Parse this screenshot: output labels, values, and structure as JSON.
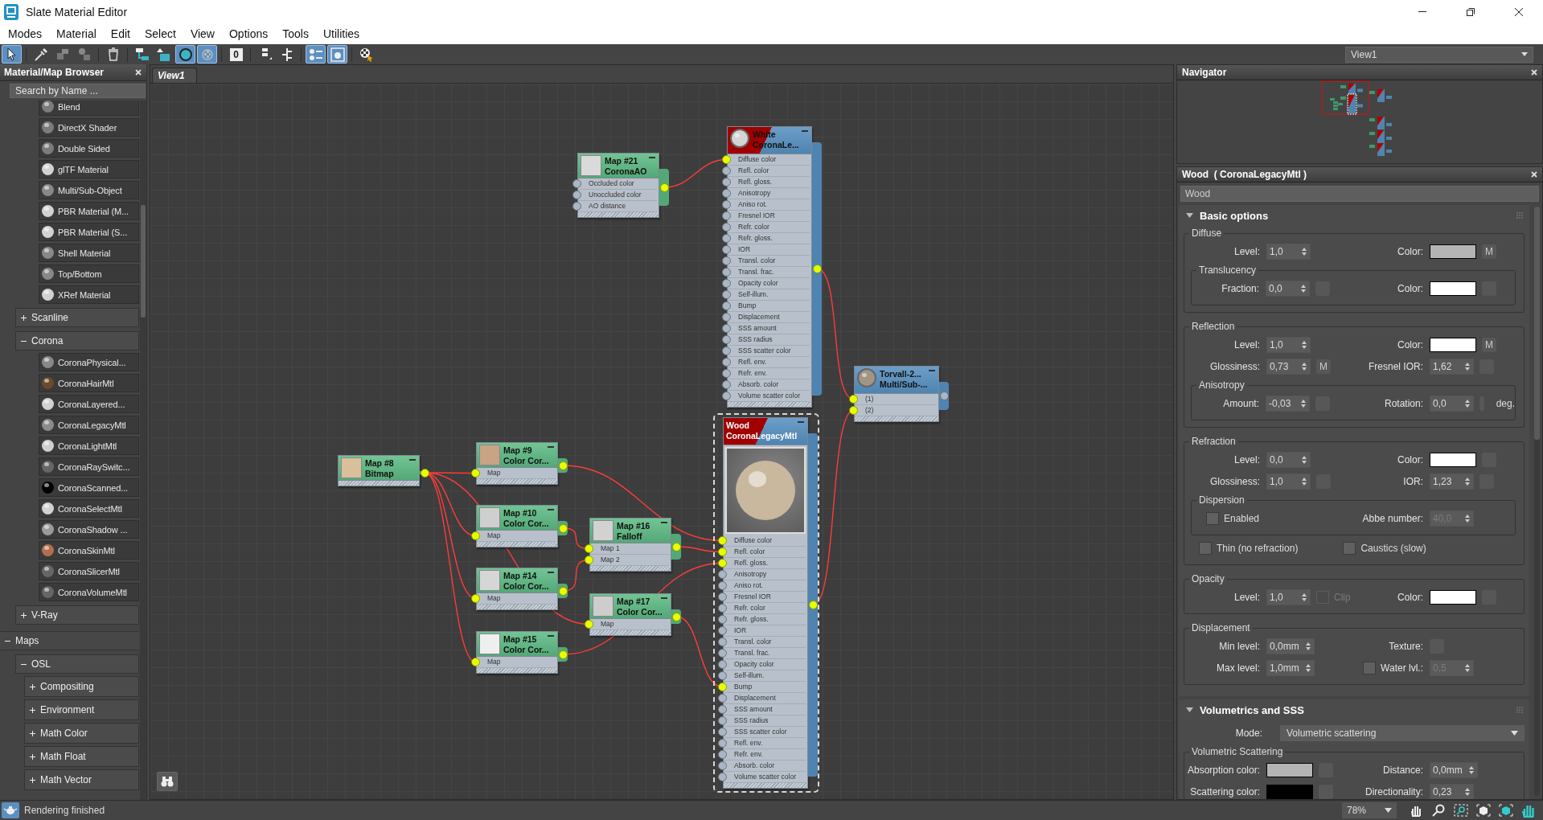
{
  "window": {
    "title": "Slate Material Editor"
  },
  "menu": [
    {
      "label": "Modes"
    },
    {
      "label": "Material"
    },
    {
      "label": "Edit"
    },
    {
      "label": "Select"
    },
    {
      "label": "View"
    },
    {
      "label": "Options"
    },
    {
      "label": "Tools"
    },
    {
      "label": "Utilities"
    }
  ],
  "toolbar": [
    {
      "kind": "pointer",
      "selected": true
    },
    {
      "kind": "eyedropper",
      "selected": false
    },
    {
      "kind": "put-to-scene",
      "selected": false
    },
    {
      "kind": "assign",
      "selected": false
    },
    {
      "kind": "delete",
      "selected": false
    },
    {
      "kind": "layout",
      "selected": false
    },
    {
      "kind": "move-children",
      "selected": false
    },
    {
      "kind": "sphere",
      "selected": true
    },
    {
      "kind": "checker",
      "selected": true
    },
    {
      "kind": "count",
      "label": "0",
      "selected": false
    },
    {
      "kind": "layout-vertical",
      "selected": false
    },
    {
      "kind": "hierarchy",
      "selected": false
    },
    {
      "kind": "params",
      "selected": true
    },
    {
      "kind": "window",
      "selected": true
    },
    {
      "kind": "pick",
      "selected": false
    }
  ],
  "view_select": {
    "value": "View1"
  },
  "browser": {
    "title": "Material/Map Browser",
    "search": {
      "placeholder": "Search by Name ..."
    },
    "tree": [
      {
        "children": [
          {
            "children": [
              {
                "kind": "item",
                "label": "Blend",
                "color": "#7c7c7c"
              },
              {
                "kind": "item",
                "label": "DirectX Shader",
                "color": "#7c7c7c"
              },
              {
                "kind": "item",
                "label": "Double Sided",
                "color": "#7c7c7c"
              },
              {
                "kind": "item",
                "label": "glTF Material",
                "color": "#d2d2d2"
              },
              {
                "kind": "item",
                "label": "Multi/Sub-Object",
                "color": "#888888"
              },
              {
                "kind": "item",
                "label": "PBR Material (M...",
                "color": "#d2d2d2"
              },
              {
                "kind": "item",
                "label": "PBR Material (S...",
                "color": "#d2d2d2"
              },
              {
                "kind": "item",
                "label": "Shell Material",
                "color": "#888888"
              },
              {
                "kind": "item",
                "label": "Top/Bottom",
                "color": "#888888"
              },
              {
                "kind": "item",
                "label": "XRef Material",
                "color": "#d2d2d2"
              }
            ]
          },
          {
            "kind": "group",
            "label": "Scanline",
            "expanded": false
          },
          {
            "kind": "group",
            "label": "Corona",
            "expanded": true,
            "children": [
              {
                "kind": "item",
                "label": "CoronaPhysical...",
                "color": "#888888"
              },
              {
                "kind": "item",
                "label": "CoronaHairMtl",
                "color": "#6b4a2a"
              },
              {
                "kind": "item",
                "label": "CoronaLayered...",
                "color": "#d2d2d2"
              },
              {
                "kind": "item",
                "label": "CoronaLegacyMtl",
                "color": "#8c8c8c"
              },
              {
                "kind": "item",
                "label": "CoronaLightMtl",
                "color": "#cfcfcf"
              },
              {
                "kind": "item",
                "label": "CoronaRaySwitc...",
                "color": "#666666"
              },
              {
                "kind": "item",
                "label": "CoronaScanned...",
                "color": "#000000"
              },
              {
                "kind": "item",
                "label": "CoronaSelectMtl",
                "color": "#d2d2d2"
              },
              {
                "kind": "item",
                "label": "CoronaShadow ...",
                "color": "#9a9a9a"
              },
              {
                "kind": "item",
                "label": "CoronaSkinMtl",
                "color": "#b07050"
              },
              {
                "kind": "item",
                "label": "CoronaSlicerMtl",
                "color": "#666666"
              },
              {
                "kind": "item",
                "label": "CoronaVolumeMtl",
                "color": "#666666"
              }
            ]
          },
          {
            "kind": "group",
            "label": "V-Ray",
            "expanded": false
          }
        ]
      },
      {
        "kind": "group",
        "label": "Maps",
        "expanded": true,
        "children": [
          {
            "kind": "group",
            "label": "OSL",
            "expanded": true,
            "children": [
              {
                "kind": "group",
                "label": "Compositing",
                "expanded": false
              },
              {
                "kind": "group",
                "label": "Environment",
                "expanded": false
              },
              {
                "kind": "group",
                "label": "Math Color",
                "expanded": false
              },
              {
                "kind": "group",
                "label": "Math Float",
                "expanded": false
              },
              {
                "kind": "group",
                "label": "Math Vector",
                "expanded": false
              }
            ]
          }
        ]
      }
    ]
  },
  "graph": {
    "tab": {
      "label": "View1",
      "selected": true
    },
    "nodes": [
      {
        "kind": "map",
        "name": "Map #21",
        "type": "CoronaAO",
        "color": "#dadada",
        "selected": false,
        "output_connected": true,
        "ports": [
          {
            "label": "Occluded color",
            "connected": false
          },
          {
            "label": "Unoccluded color",
            "connected": false
          },
          {
            "label": "AO distance",
            "connected": false
          }
        ]
      },
      {
        "kind": "material",
        "name": "White",
        "type": "CoronaLe...",
        "color": "#d4d4d4",
        "assigned": true,
        "selected": false,
        "large_preview": false,
        "output_connected": true,
        "ports": [
          {
            "label": "Diffuse color",
            "connected": true
          },
          {
            "label": "Refl. color",
            "connected": false
          },
          {
            "label": "Refl. gloss.",
            "connected": false
          },
          {
            "label": "Anisotropy",
            "connected": false
          },
          {
            "label": "Aniso rot.",
            "connected": false
          },
          {
            "label": "Fresnel IOR",
            "connected": false
          },
          {
            "label": "Refr. color",
            "connected": false
          },
          {
            "label": "Refr. gloss.",
            "connected": false
          },
          {
            "label": "IOR",
            "connected": false
          },
          {
            "label": "Transl. color",
            "connected": false
          },
          {
            "label": "Transl. frac.",
            "connected": false
          },
          {
            "label": "Opacity color",
            "connected": false
          },
          {
            "label": "Self-illum.",
            "connected": false
          },
          {
            "label": "Bump",
            "connected": false
          },
          {
            "label": "Displacement",
            "connected": false
          },
          {
            "label": "SSS amount",
            "connected": false
          },
          {
            "label": "SSS radius",
            "connected": false
          },
          {
            "label": "SSS scatter color",
            "connected": false
          },
          {
            "label": "Refl. env.",
            "connected": false
          },
          {
            "label": "Refr. env.",
            "connected": false
          },
          {
            "label": "Absorb. color",
            "connected": false
          },
          {
            "label": "Volume scatter color",
            "connected": false
          }
        ]
      },
      {
        "kind": "material",
        "name": "Torvall-2...",
        "type": "Multi/Sub-...",
        "color": "#a09686",
        "assigned": false,
        "selected": false,
        "large_preview": false,
        "output_connected": false,
        "ports": [
          {
            "label": "(1)",
            "connected": true
          },
          {
            "label": "(2)",
            "connected": true
          }
        ]
      },
      {
        "kind": "material",
        "name": "Wood",
        "type": "CoronaLegacyMtl",
        "color": "#c9b89e",
        "assigned": true,
        "selected": true,
        "large_preview": true,
        "output_connected": true,
        "ports": [
          {
            "label": "Diffuse color",
            "connected": true
          },
          {
            "label": "Refl. color",
            "connected": true
          },
          {
            "label": "Refl. gloss.",
            "connected": true
          },
          {
            "label": "Anisotropy",
            "connected": false
          },
          {
            "label": "Aniso rot.",
            "connected": false
          },
          {
            "label": "Fresnel IOR",
            "connected": false
          },
          {
            "label": "Refr. color",
            "connected": false
          },
          {
            "label": "Refr. gloss.",
            "connected": false
          },
          {
            "label": "IOR",
            "connected": false
          },
          {
            "label": "Transl. color",
            "connected": false
          },
          {
            "label": "Transl. frac.",
            "connected": false
          },
          {
            "label": "Opacity color",
            "connected": false
          },
          {
            "label": "Self-illum.",
            "connected": false
          },
          {
            "label": "Bump",
            "connected": true
          },
          {
            "label": "Displacement",
            "connected": false
          },
          {
            "label": "SSS amount",
            "connected": false
          },
          {
            "label": "SSS radius",
            "connected": false
          },
          {
            "label": "SSS scatter color",
            "connected": false
          },
          {
            "label": "Refl. env.",
            "connected": false
          },
          {
            "label": "Refr. env.",
            "connected": false
          },
          {
            "label": "Absorb. color",
            "connected": false
          },
          {
            "label": "Volume scatter color",
            "connected": false
          }
        ]
      },
      {
        "kind": "map",
        "name": "Map #8",
        "type": "Bitmap",
        "color": "#d9bf9a",
        "selected": false,
        "output_connected": true
      },
      {
        "kind": "map",
        "name": "Map #9",
        "type": "Color Cor...",
        "color": "#c8a484",
        "selected": false,
        "output_connected": true,
        "ports": [
          {
            "label": "Map",
            "connected": true
          }
        ]
      },
      {
        "kind": "map",
        "name": "Map #10",
        "type": "Color Cor...",
        "color": "#cfcfcf",
        "selected": false,
        "output_connected": true,
        "ports": [
          {
            "label": "Map",
            "connected": true
          }
        ]
      },
      {
        "kind": "map",
        "name": "Map #14",
        "type": "Color Cor...",
        "color": "#d6d6d6",
        "selected": false,
        "output_connected": true,
        "ports": [
          {
            "label": "Map",
            "connected": true
          }
        ]
      },
      {
        "kind": "map",
        "name": "Map #15",
        "type": "Color Cor...",
        "color": "#efefef",
        "selected": false,
        "output_connected": true,
        "ports": [
          {
            "label": "Map",
            "connected": true
          }
        ]
      },
      {
        "kind": "map",
        "name": "Map #16",
        "type": "Falloff",
        "color": "#d2d2d2",
        "selected": false,
        "output_connected": true,
        "ports": [
          {
            "label": "Map 1",
            "connected": true
          },
          {
            "label": "Map 2",
            "connected": true
          }
        ]
      },
      {
        "kind": "map",
        "name": "Map #17",
        "type": "Color Cor...",
        "color": "#cdcdcd",
        "selected": false,
        "output_connected": true,
        "ports": [
          {
            "label": "Map",
            "connected": true
          }
        ]
      }
    ]
  },
  "navigator": {
    "title": "Navigator"
  },
  "params": {
    "title": "Wood  ( CoronaLegacyMtl )",
    "name_field": {
      "value": "Wood"
    },
    "rollouts": [
      {
        "title": "Basic options",
        "expanded": true,
        "content": [
          {
            "kind": "group",
            "title": "Diffuse",
            "content": [
              {
                "kind": "row",
                "left": {
                  "label": "Level:",
                  "controls": [
                    {
                      "kind": "spinner",
                      "value": "1,0",
                      "disabled": false
                    }
                  ]
                },
                "right": {
                  "label": "Color:",
                  "controls": [
                    {
                      "kind": "swatch",
                      "color": "#b4b4b4"
                    },
                    {
                      "kind": "map",
                      "assigned": true,
                      "label": "M"
                    }
                  ]
                }
              },
              {
                "kind": "group",
                "title": "Translucency",
                "content": [
                  {
                    "kind": "row",
                    "left": {
                      "label": "Fraction:",
                      "controls": [
                        {
                          "kind": "spinner",
                          "value": "0,0",
                          "disabled": false
                        },
                        {
                          "kind": "map",
                          "assigned": false
                        }
                      ]
                    },
                    "right": {
                      "label": "Color:",
                      "controls": [
                        {
                          "kind": "swatch",
                          "color": "#ffffff"
                        },
                        {
                          "kind": "map",
                          "assigned": false
                        }
                      ]
                    }
                  }
                ]
              }
            ]
          },
          {
            "kind": "group",
            "title": "Reflection",
            "content": [
              {
                "kind": "row",
                "left": {
                  "label": "Level:",
                  "controls": [
                    {
                      "kind": "spinner",
                      "value": "1,0",
                      "disabled": false
                    }
                  ]
                },
                "right": {
                  "label": "Color:",
                  "controls": [
                    {
                      "kind": "swatch",
                      "color": "#ffffff"
                    },
                    {
                      "kind": "map",
                      "assigned": true,
                      "label": "M"
                    }
                  ]
                }
              },
              {
                "kind": "row",
                "left": {
                  "label": "Glossiness:",
                  "controls": [
                    {
                      "kind": "spinner",
                      "value": "0,73",
                      "disabled": false
                    },
                    {
                      "kind": "map",
                      "assigned": true,
                      "label": "M"
                    }
                  ]
                },
                "right": {
                  "label": "Fresnel IOR:",
                  "controls": [
                    {
                      "kind": "spinner",
                      "value": "1,62",
                      "disabled": false
                    },
                    {
                      "kind": "map",
                      "assigned": false
                    }
                  ]
                }
              },
              {
                "kind": "group",
                "title": "Anisotropy",
                "content": [
                  {
                    "kind": "row",
                    "left": {
                      "label": "Amount:",
                      "controls": [
                        {
                          "kind": "spinner",
                          "value": "-0,03",
                          "disabled": false
                        },
                        {
                          "kind": "map",
                          "assigned": false
                        }
                      ]
                    },
                    "right": {
                      "label": "Rotation:",
                      "controls": [
                        {
                          "kind": "spinner",
                          "value": "0,0",
                          "disabled": false
                        },
                        {
                          "kind": "map",
                          "assigned": false
                        },
                        {
                          "kind": "unit",
                          "text": "deg."
                        }
                      ]
                    }
                  }
                ]
              }
            ]
          },
          {
            "kind": "group",
            "title": "Refraction",
            "content": [
              {
                "kind": "row",
                "left": {
                  "label": "Level:",
                  "controls": [
                    {
                      "kind": "spinner",
                      "value": "0,0",
                      "disabled": false
                    }
                  ]
                },
                "right": {
                  "label": "Color:",
                  "controls": [
                    {
                      "kind": "swatch",
                      "color": "#ffffff"
                    },
                    {
                      "kind": "map",
                      "assigned": false
                    }
                  ]
                }
              },
              {
                "kind": "row",
                "left": {
                  "label": "Glossiness:",
                  "controls": [
                    {
                      "kind": "spinner",
                      "value": "1,0",
                      "disabled": false
                    },
                    {
                      "kind": "map",
                      "assigned": false
                    }
                  ]
                },
                "right": {
                  "label": "IOR:",
                  "controls": [
                    {
                      "kind": "spinner",
                      "value": "1,23",
                      "disabled": false
                    },
                    {
                      "kind": "map",
                      "assigned": false
                    }
                  ]
                }
              },
              {
                "kind": "group",
                "title": "Dispersion",
                "content": [
                  {
                    "kind": "row",
                    "left": {
                      "controls": [
                        {
                          "kind": "checkbox",
                          "label": "Enabled",
                          "checked": false,
                          "disabled": false
                        }
                      ]
                    },
                    "right": {
                      "label": "Abbe number:",
                      "controls": [
                        {
                          "kind": "spinner",
                          "value": "40,0",
                          "disabled": true
                        }
                      ]
                    }
                  }
                ]
              },
              {
                "kind": "row",
                "left": {
                  "controls": [
                    {
                      "kind": "checkbox",
                      "label": "Thin (no refraction)",
                      "checked": false,
                      "disabled": false
                    }
                  ]
                },
                "right": {
                  "controls": [
                    {
                      "kind": "checkbox",
                      "label": "Caustics (slow)",
                      "checked": false,
                      "disabled": false
                    }
                  ]
                }
              }
            ]
          },
          {
            "kind": "group",
            "title": "Opacity",
            "content": [
              {
                "kind": "row",
                "left": {
                  "label": "Level:",
                  "controls": [
                    {
                      "kind": "spinner",
                      "value": "1,0",
                      "disabled": false
                    },
                    {
                      "kind": "checkbox",
                      "label": "Clip",
                      "checked": false,
                      "disabled": true
                    }
                  ]
                },
                "right": {
                  "label": "Color:",
                  "controls": [
                    {
                      "kind": "swatch",
                      "color": "#ffffff"
                    },
                    {
                      "kind": "map",
                      "assigned": false
                    }
                  ]
                }
              }
            ]
          },
          {
            "kind": "group",
            "title": "Displacement",
            "content": [
              {
                "kind": "row",
                "left": {
                  "label": "Min level:",
                  "controls": [
                    {
                      "kind": "spinner",
                      "value": "0,0mm",
                      "disabled": false
                    }
                  ]
                },
                "right": {
                  "label": "Texture:",
                  "controls": [
                    {
                      "kind": "map",
                      "assigned": false
                    }
                  ]
                }
              },
              {
                "kind": "row",
                "left": {
                  "label": "Max level:",
                  "controls": [
                    {
                      "kind": "spinner",
                      "value": "1,0mm",
                      "disabled": false
                    }
                  ]
                },
                "right": {
                  "label": "Water lvl.:",
                  "label_checkbox": {
                    "checked": false
                  },
                  "controls": [
                    {
                      "kind": "spinner",
                      "value": "0,5",
                      "disabled": true
                    }
                  ]
                }
              }
            ]
          }
        ]
      },
      {
        "title": "Volumetrics and SSS",
        "expanded": true,
        "content": [
          {
            "kind": "row",
            "left": {
              "label": "Mode:",
              "controls": [
                {
                  "kind": "dropdown",
                  "value": "Volumetric scattering"
                }
              ]
            }
          },
          {
            "kind": "group",
            "title": "Volumetric Scattering",
            "content": [
              {
                "kind": "row",
                "left": {
                  "label": "Absorption color:",
                  "controls": [
                    {
                      "kind": "swatch",
                      "color": "#b4b4b4"
                    },
                    {
                      "kind": "map",
                      "assigned": false
                    }
                  ]
                },
                "right": {
                  "label": "Distance:",
                  "controls": [
                    {
                      "kind": "spinner",
                      "value": "0,0mm",
                      "disabled": false
                    }
                  ]
                }
              },
              {
                "kind": "row",
                "left": {
                  "label": "Scattering color:",
                  "controls": [
                    {
                      "kind": "swatch",
                      "color": "#000000"
                    },
                    {
                      "kind": "map",
                      "assigned": false
                    }
                  ]
                },
                "right": {
                  "label": "Directionality:",
                  "controls": [
                    {
                      "kind": "spinner",
                      "value": "0,23",
                      "disabled": false
                    }
                  ]
                }
              }
            ]
          }
        ]
      }
    ]
  },
  "status_bar": {
    "message": "Rendering finished",
    "zoom": {
      "value": "78%"
    }
  }
}
